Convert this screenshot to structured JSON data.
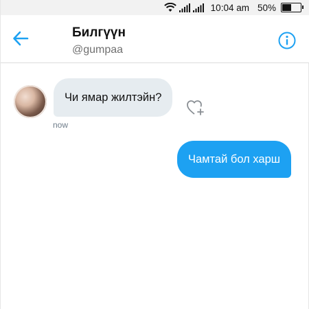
{
  "status_bar": {
    "time": "10:04 am",
    "battery_percent": "50%",
    "battery_level": 0.5,
    "icons": [
      "wifi-icon",
      "signal-icon",
      "signal-icon",
      "battery-icon"
    ]
  },
  "header": {
    "name": "Билгүүн",
    "handle": "@gumpaa",
    "back_icon": "arrow-left-icon",
    "info_icon": "info-icon",
    "accent_color": "#1da1f2"
  },
  "messages": [
    {
      "direction": "incoming",
      "text": "Чи ямар жилтэйн?",
      "timestamp": "now",
      "bubble_color": "#e6ecf0",
      "action_icon": "heart-plus-icon"
    },
    {
      "direction": "outgoing",
      "text": "Чамтай бол харш",
      "bubble_color": "#1da1f2"
    }
  ]
}
